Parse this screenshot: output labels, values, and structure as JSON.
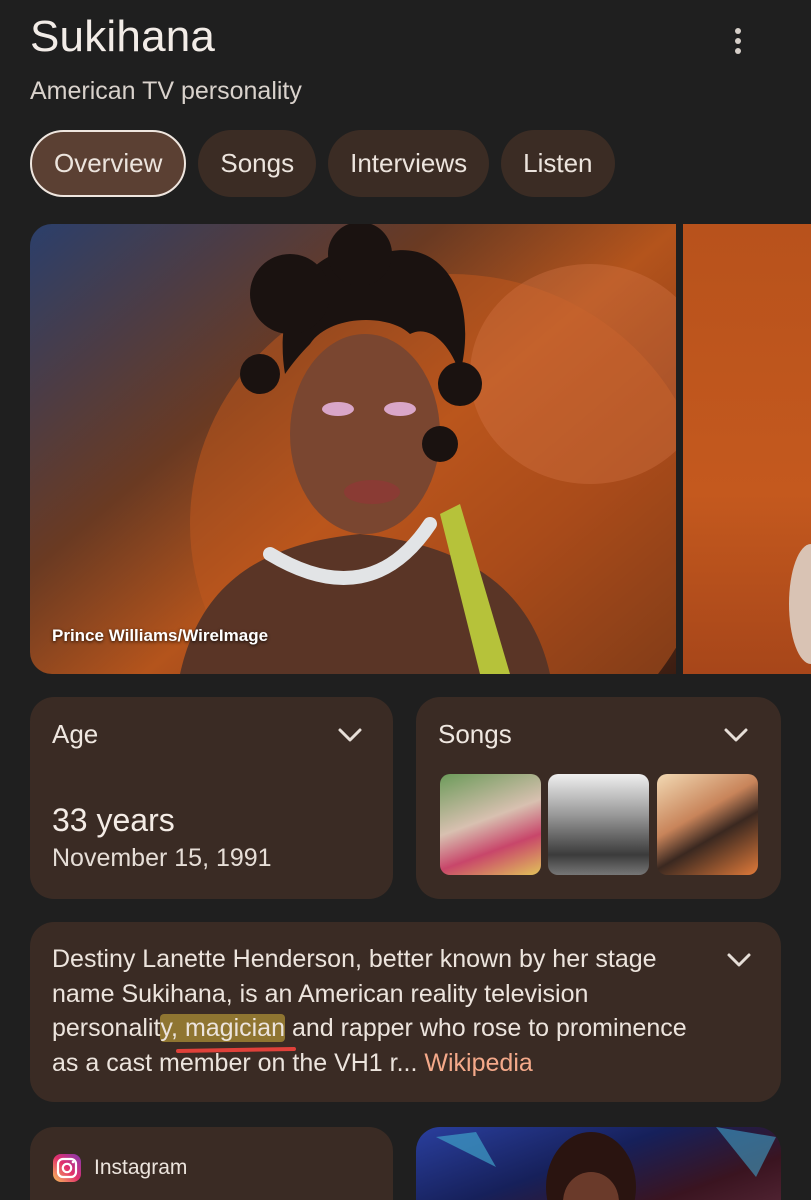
{
  "header": {
    "title": "Sukihana",
    "subtitle": "American TV personality"
  },
  "tabs": [
    {
      "label": "Overview",
      "active": true
    },
    {
      "label": "Songs",
      "active": false
    },
    {
      "label": "Interviews",
      "active": false
    },
    {
      "label": "Listen",
      "active": false
    }
  ],
  "media": {
    "credit": "Prince Williams/WireImage"
  },
  "age_card": {
    "title": "Age",
    "value": "33 years",
    "date": "November 15, 1991"
  },
  "songs_card": {
    "title": "Songs"
  },
  "description": {
    "text_before": "Destiny Lanette Henderson, better known by her stage name Sukihana, is an American reality television personalit",
    "highlighted": "y, magician",
    "text_after": " and rapper who rose to prominence as a cast member on the VH1 r",
    "ellipsis": "... ",
    "source_link": "Wikipedia"
  },
  "social": {
    "instagram_label": "Instagram"
  },
  "colors": {
    "background": "#1f1f1f",
    "card": "#3a2b24",
    "tab": "#3b2c24",
    "tab_active": "#5b4033",
    "link": "#f4a98a"
  }
}
